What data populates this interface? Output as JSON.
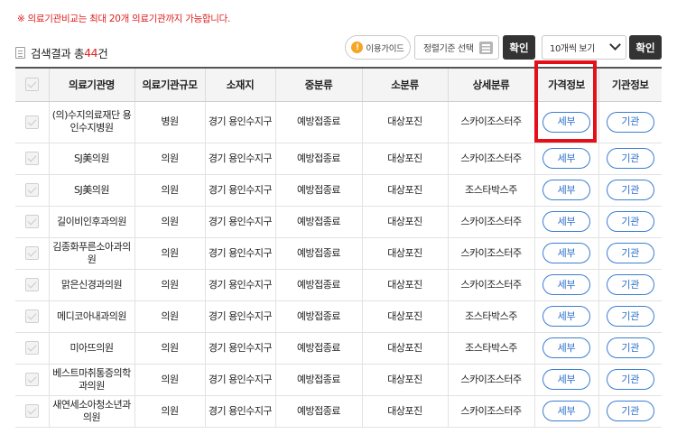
{
  "notice": "※ 의료기관비교는 최대 20개 의료기관까지 가능합니다.",
  "result": {
    "prefix": "검색결과 총 ",
    "count": "44",
    "suffix": "건"
  },
  "controls": {
    "guide_label": "이용가이드",
    "sort_label": "정렬기준 선택",
    "confirm_label": "확인",
    "page_size_label": "10개씩 보기"
  },
  "table": {
    "headers": [
      "의료기관명",
      "의료기관규모",
      "소재지",
      "중분류",
      "소분류",
      "상세분류",
      "가격정보",
      "기관정보"
    ],
    "detail_label": "세부",
    "institution_label": "기관",
    "rows": [
      {
        "name": "(의)수지의료재단 용인수지병원",
        "size": "병원",
        "location": "경기 용인수지구",
        "mid": "예방접종료",
        "small": "대상포진",
        "detail": "스카이조스터주"
      },
      {
        "name": "SJ美의원",
        "size": "의원",
        "location": "경기 용인수지구",
        "mid": "예방접종료",
        "small": "대상포진",
        "detail": "스카이조스터주"
      },
      {
        "name": "SJ美의원",
        "size": "의원",
        "location": "경기 용인수지구",
        "mid": "예방접종료",
        "small": "대상포진",
        "detail": "조스타박스주"
      },
      {
        "name": "길이비인후과의원",
        "size": "의원",
        "location": "경기 용인수지구",
        "mid": "예방접종료",
        "small": "대상포진",
        "detail": "스카이조스터주"
      },
      {
        "name": "김종화푸른소아과의원",
        "size": "의원",
        "location": "경기 용인수지구",
        "mid": "예방접종료",
        "small": "대상포진",
        "detail": "스카이조스터주"
      },
      {
        "name": "맑은신경과의원",
        "size": "의원",
        "location": "경기 용인수지구",
        "mid": "예방접종료",
        "small": "대상포진",
        "detail": "스카이조스터주"
      },
      {
        "name": "메디코아내과의원",
        "size": "의원",
        "location": "경기 용인수지구",
        "mid": "예방접종료",
        "small": "대상포진",
        "detail": "조스타박스주"
      },
      {
        "name": "미아뜨의원",
        "size": "의원",
        "location": "경기 용인수지구",
        "mid": "예방접종료",
        "small": "대상포진",
        "detail": "조스타박스주"
      },
      {
        "name": "베스트마취통증의학과의원",
        "size": "의원",
        "location": "경기 용인수지구",
        "mid": "예방접종료",
        "small": "대상포진",
        "detail": "스카이조스터주"
      },
      {
        "name": "새연세소아청소년과의원",
        "size": "의원",
        "location": "경기 용인수지구",
        "mid": "예방접종료",
        "small": "대상포진",
        "detail": "스카이조스터주"
      }
    ]
  },
  "colors": {
    "notice": "#e02020",
    "highlight": "#e3101a",
    "pill": "#3b7fd4",
    "dark_button": "#333333"
  }
}
